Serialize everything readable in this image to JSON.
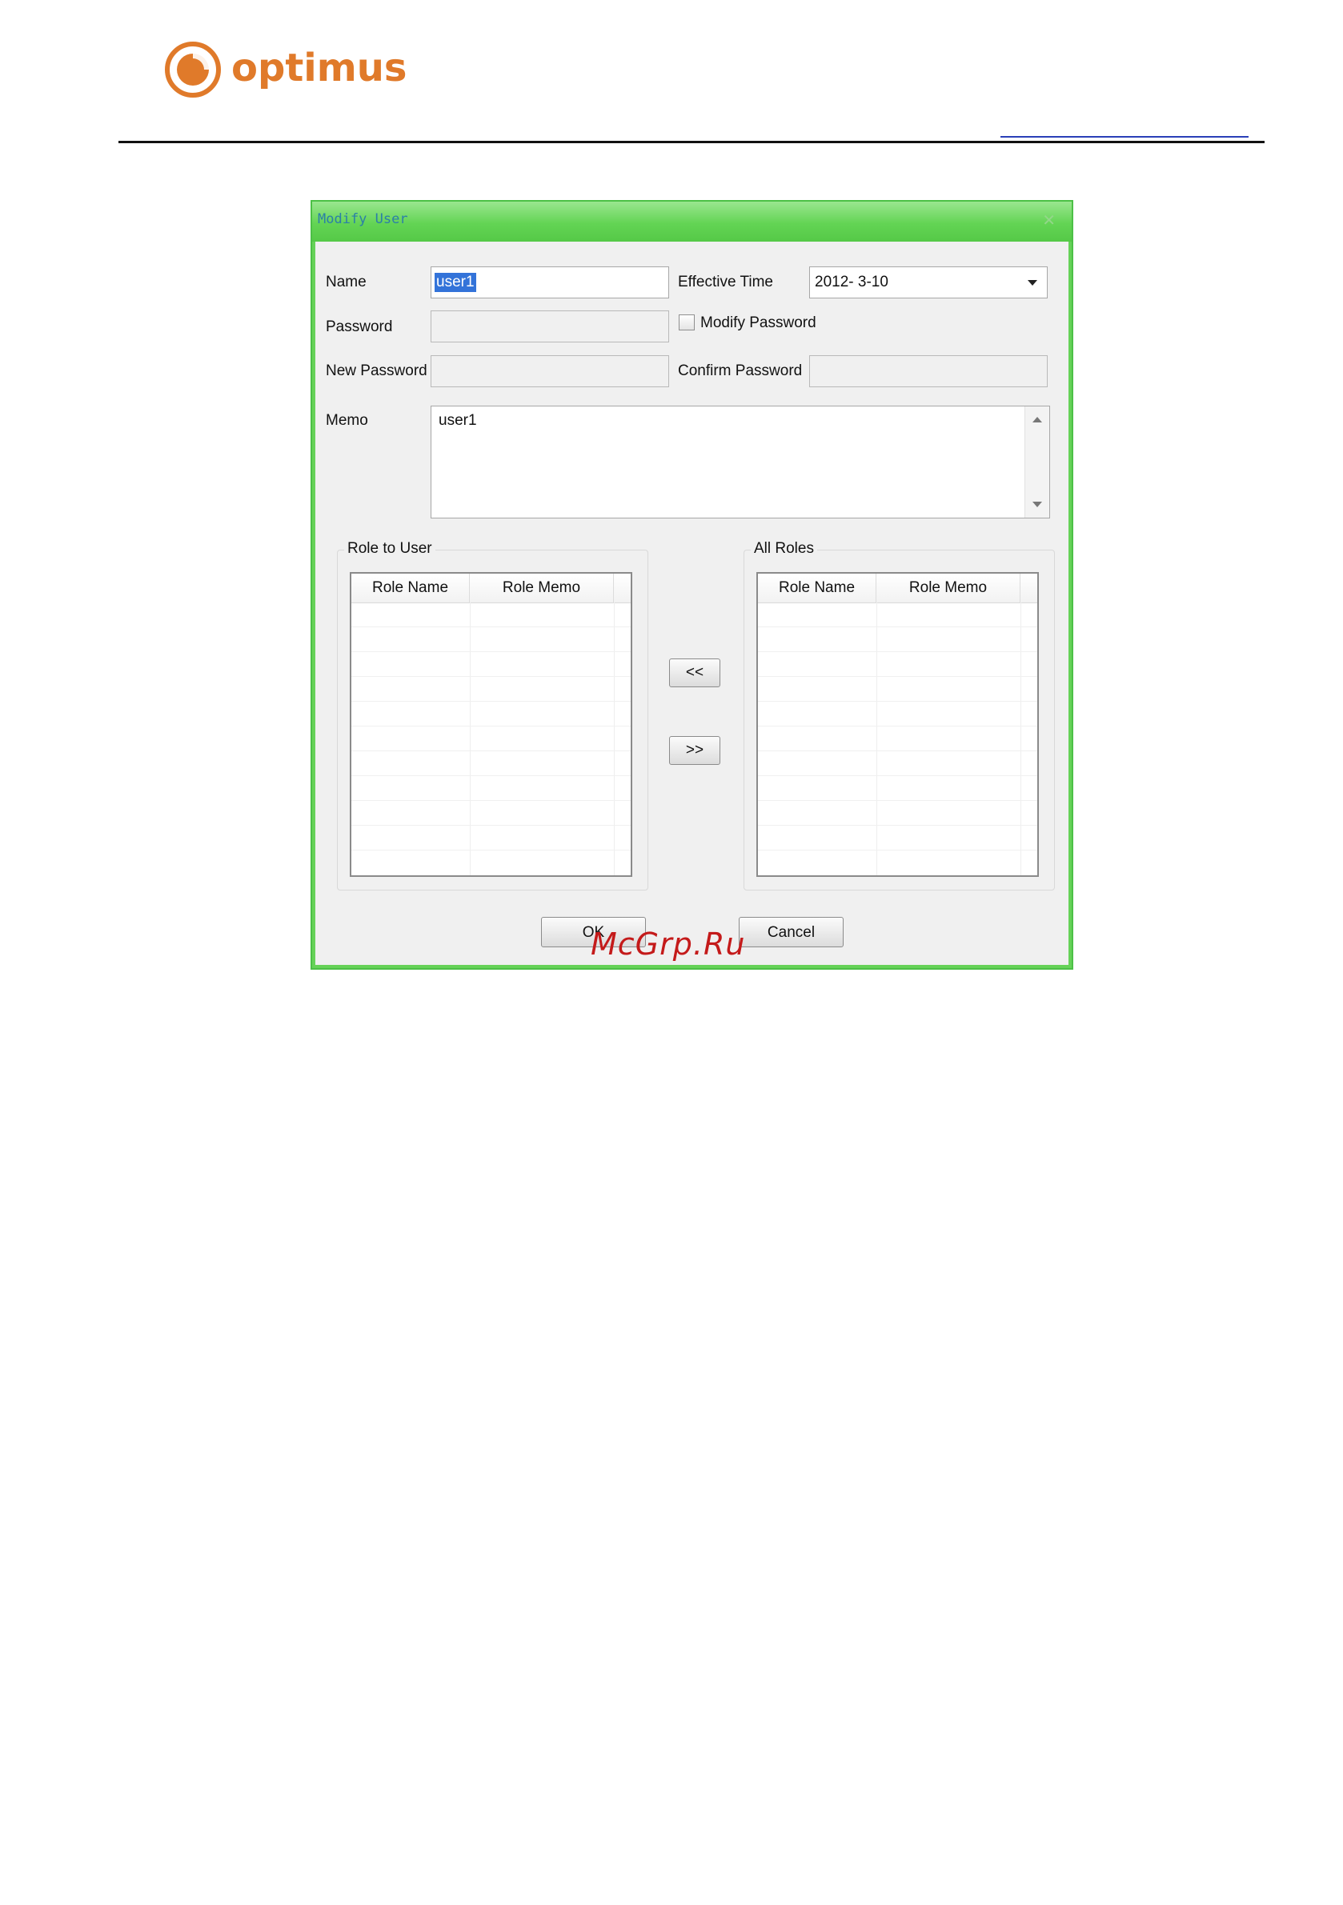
{
  "page": {
    "logo_text": "optimus",
    "logo_color": "#e07a2a",
    "watermark": "McGrp.Ru"
  },
  "dialog": {
    "title": "Modify User",
    "close_icon": "close-icon",
    "accent_color": "#55c947",
    "name": {
      "label": "Name",
      "value": "user1"
    },
    "effective_time": {
      "label": "Effective Time",
      "value": "2012-  3-10"
    },
    "password": {
      "label": "Password",
      "value": ""
    },
    "modify_password": {
      "label": "Modify Password",
      "checked": false
    },
    "new_password": {
      "label": "New Password",
      "value": ""
    },
    "confirm_password": {
      "label": "Confirm Password",
      "value": ""
    },
    "memo": {
      "label": "Memo",
      "value": "user1"
    },
    "role_to_user": {
      "title": "Role to User",
      "columns": [
        "Role Name",
        "Role Memo"
      ],
      "rows": []
    },
    "all_roles": {
      "title": "All Roles",
      "columns": [
        "Role Name",
        "Role Memo"
      ],
      "rows": []
    },
    "add_role_button": "<<",
    "remove_role_button": ">>",
    "ok_button": "OK",
    "cancel_button": "Cancel"
  }
}
